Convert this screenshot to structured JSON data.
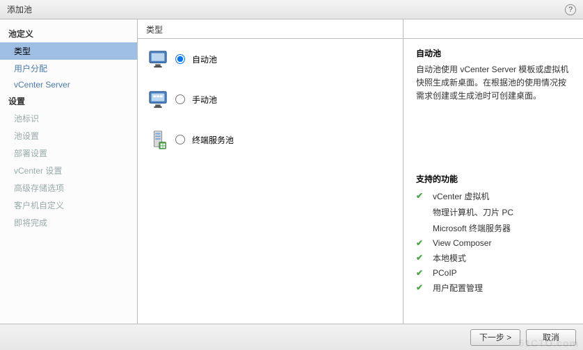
{
  "title": "添加池",
  "sidebar": {
    "section1": {
      "heading": "池定义",
      "items": [
        {
          "label": "类型",
          "selected": true
        },
        {
          "label": "用户分配",
          "selected": false
        },
        {
          "label": "vCenter Server",
          "selected": false
        }
      ]
    },
    "section2": {
      "heading": "设置",
      "items": [
        {
          "label": "池标识"
        },
        {
          "label": "池设置"
        },
        {
          "label": "部署设置"
        },
        {
          "label": "vCenter 设置"
        },
        {
          "label": "高级存储选项"
        },
        {
          "label": "客户机自定义"
        },
        {
          "label": "即将完成"
        }
      ]
    }
  },
  "content_header": "类型",
  "options": [
    {
      "id": "auto",
      "label": "自动池",
      "checked": true
    },
    {
      "id": "manual",
      "label": "手动池",
      "checked": false
    },
    {
      "id": "terminal",
      "label": "终端服务池",
      "checked": false
    }
  ],
  "info": {
    "title": "自动池",
    "description": "自动池使用 vCenter Server 模板或虚拟机快照生成新桌面。在根据池的使用情况按需求创建或生成池时可创建桌面。"
  },
  "features_title": "支持的功能",
  "features": [
    {
      "check": true,
      "label": "vCenter 虚拟机"
    },
    {
      "check": false,
      "label": "物理计算机、刀片 PC"
    },
    {
      "check": false,
      "label": "Microsoft 终端服务器"
    },
    {
      "check": true,
      "label": "View Composer"
    },
    {
      "check": true,
      "label": "本地模式"
    },
    {
      "check": true,
      "label": "PCoIP"
    },
    {
      "check": true,
      "label": "用户配置管理"
    }
  ],
  "buttons": {
    "next": "下一步 >",
    "cancel": "取消"
  },
  "watermark": "51CTO.com"
}
